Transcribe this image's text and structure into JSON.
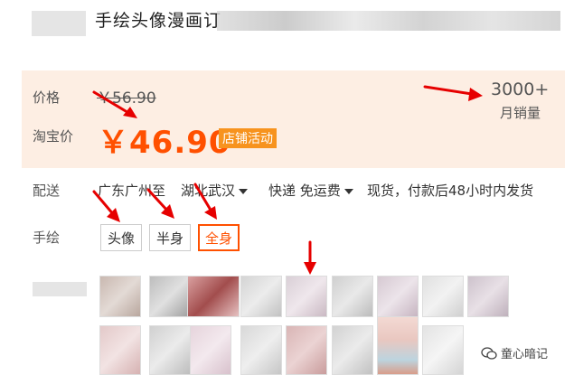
{
  "product": {
    "title": "手绘头像漫画订"
  },
  "price": {
    "label": "价格",
    "original": "￥56.90",
    "taobao_label": "淘宝价",
    "taobao_price": "￥46.90",
    "promo_tag": "店铺活动"
  },
  "sales": {
    "count": "3000+",
    "label": "月销量"
  },
  "shipping": {
    "label": "配送",
    "from": "广东广州至",
    "to": "湖北武汉",
    "method": "快递 免运费",
    "note": "现货，付款后48小时内发货"
  },
  "options": {
    "label": "手绘",
    "items": [
      "头像",
      "半身",
      "全身"
    ],
    "selected": "全身"
  },
  "watermark": {
    "text": "童心暗记"
  },
  "colors": {
    "accent": "#ff5000",
    "promo": "#f7931e",
    "arrow": "#e60000",
    "panel": "#fdeee3"
  }
}
